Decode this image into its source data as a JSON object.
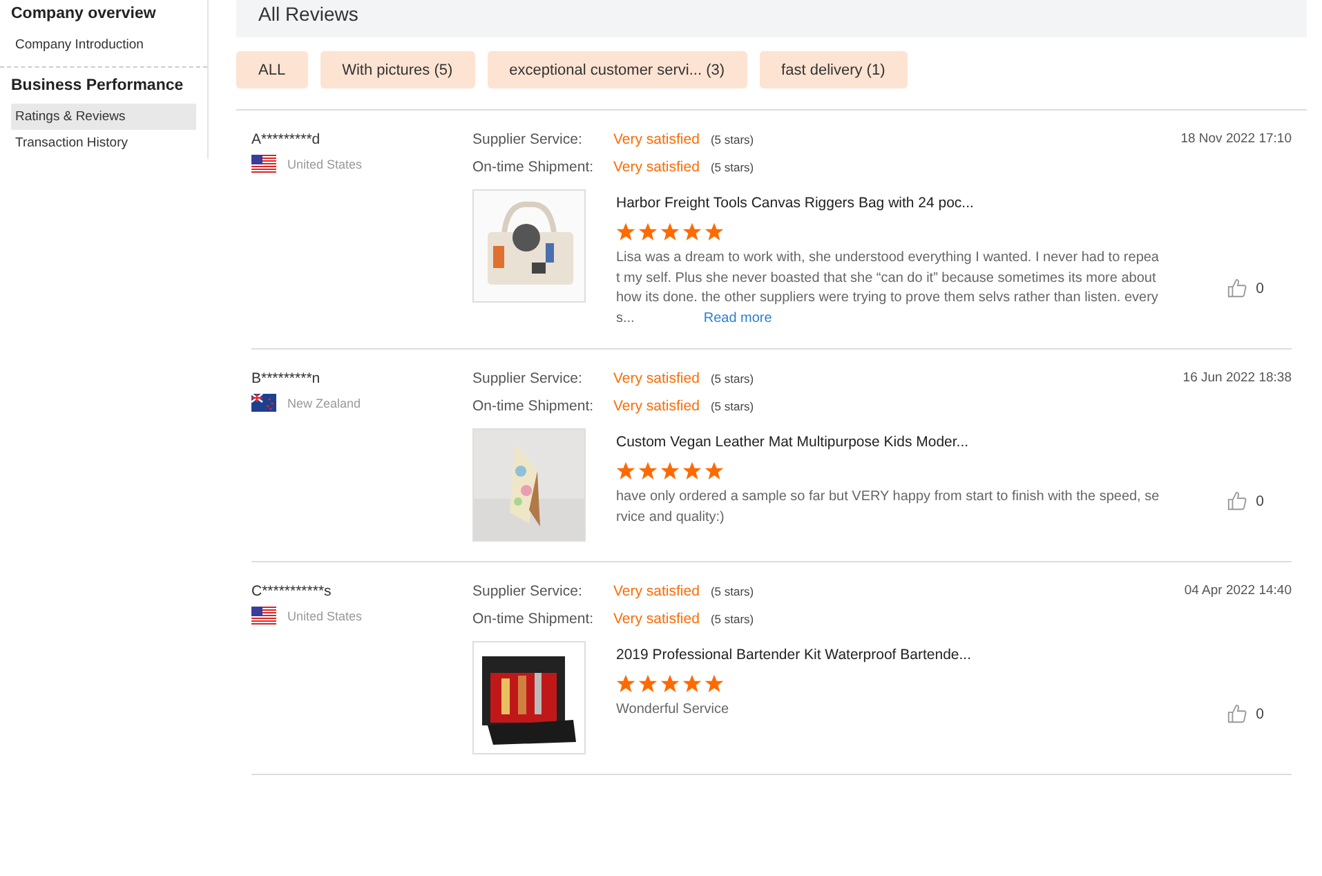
{
  "sidebar": {
    "sections": [
      {
        "title": "Company overview",
        "items": [
          {
            "label": "Company Introduction",
            "selected": false
          }
        ]
      },
      {
        "title": "Business Performance",
        "items": [
          {
            "label": "Ratings & Reviews",
            "selected": true
          },
          {
            "label": "Transaction History",
            "selected": false
          }
        ]
      }
    ]
  },
  "header": {
    "title": "All Reviews"
  },
  "filters": [
    "ALL",
    "With pictures (5)",
    "exceptional customer servi... (3)",
    "fast delivery (1)"
  ],
  "reviews": [
    {
      "user": "A*********d",
      "kind": "us",
      "country": "United States",
      "date": "18 Nov 2022 17:10",
      "ratings": [
        {
          "label": "Supplier Service:",
          "value": "Very satisfied",
          "stars_text": "(5 stars)"
        },
        {
          "label": "On-time Shipment:",
          "value": "Very satisfied",
          "stars_text": "(5 stars)"
        }
      ],
      "product": "Harbor Freight Tools Canvas Riggers Bag with 24 poc...",
      "stars": 5,
      "text": "Lisa was a dream to work with, she understood everything I wanted. I never had to repeat my self. Plus she never boasted that she “can do it” because sometimes its more about how its done. the other suppliers were trying to prove them selvs rather than listen. every s...",
      "read_more": "Read more",
      "likes": "0"
    },
    {
      "user": "B*********n",
      "kind": "nz",
      "country": "New Zealand",
      "date": "16 Jun 2022 18:38",
      "ratings": [
        {
          "label": "Supplier Service:",
          "value": "Very satisfied",
          "stars_text": "(5 stars)"
        },
        {
          "label": "On-time Shipment:",
          "value": "Very satisfied",
          "stars_text": "(5 stars)"
        }
      ],
      "product": "Custom Vegan Leather Mat Multipurpose Kids Moder...",
      "stars": 5,
      "text": "have only ordered a sample so far but VERY happy from start to finish with the speed, service and quality:)",
      "likes": "0"
    },
    {
      "user": "C***********s",
      "kind": "us",
      "country": "United States",
      "date": "04 Apr 2022 14:40",
      "ratings": [
        {
          "label": "Supplier Service:",
          "value": "Very satisfied",
          "stars_text": "(5 stars)"
        },
        {
          "label": "On-time Shipment:",
          "value": "Very satisfied",
          "stars_text": "(5 stars)"
        }
      ],
      "product": "2019 Professional Bartender Kit Waterproof Bartende...",
      "stars": 5,
      "text": "Wonderful Service",
      "likes": "0"
    }
  ]
}
